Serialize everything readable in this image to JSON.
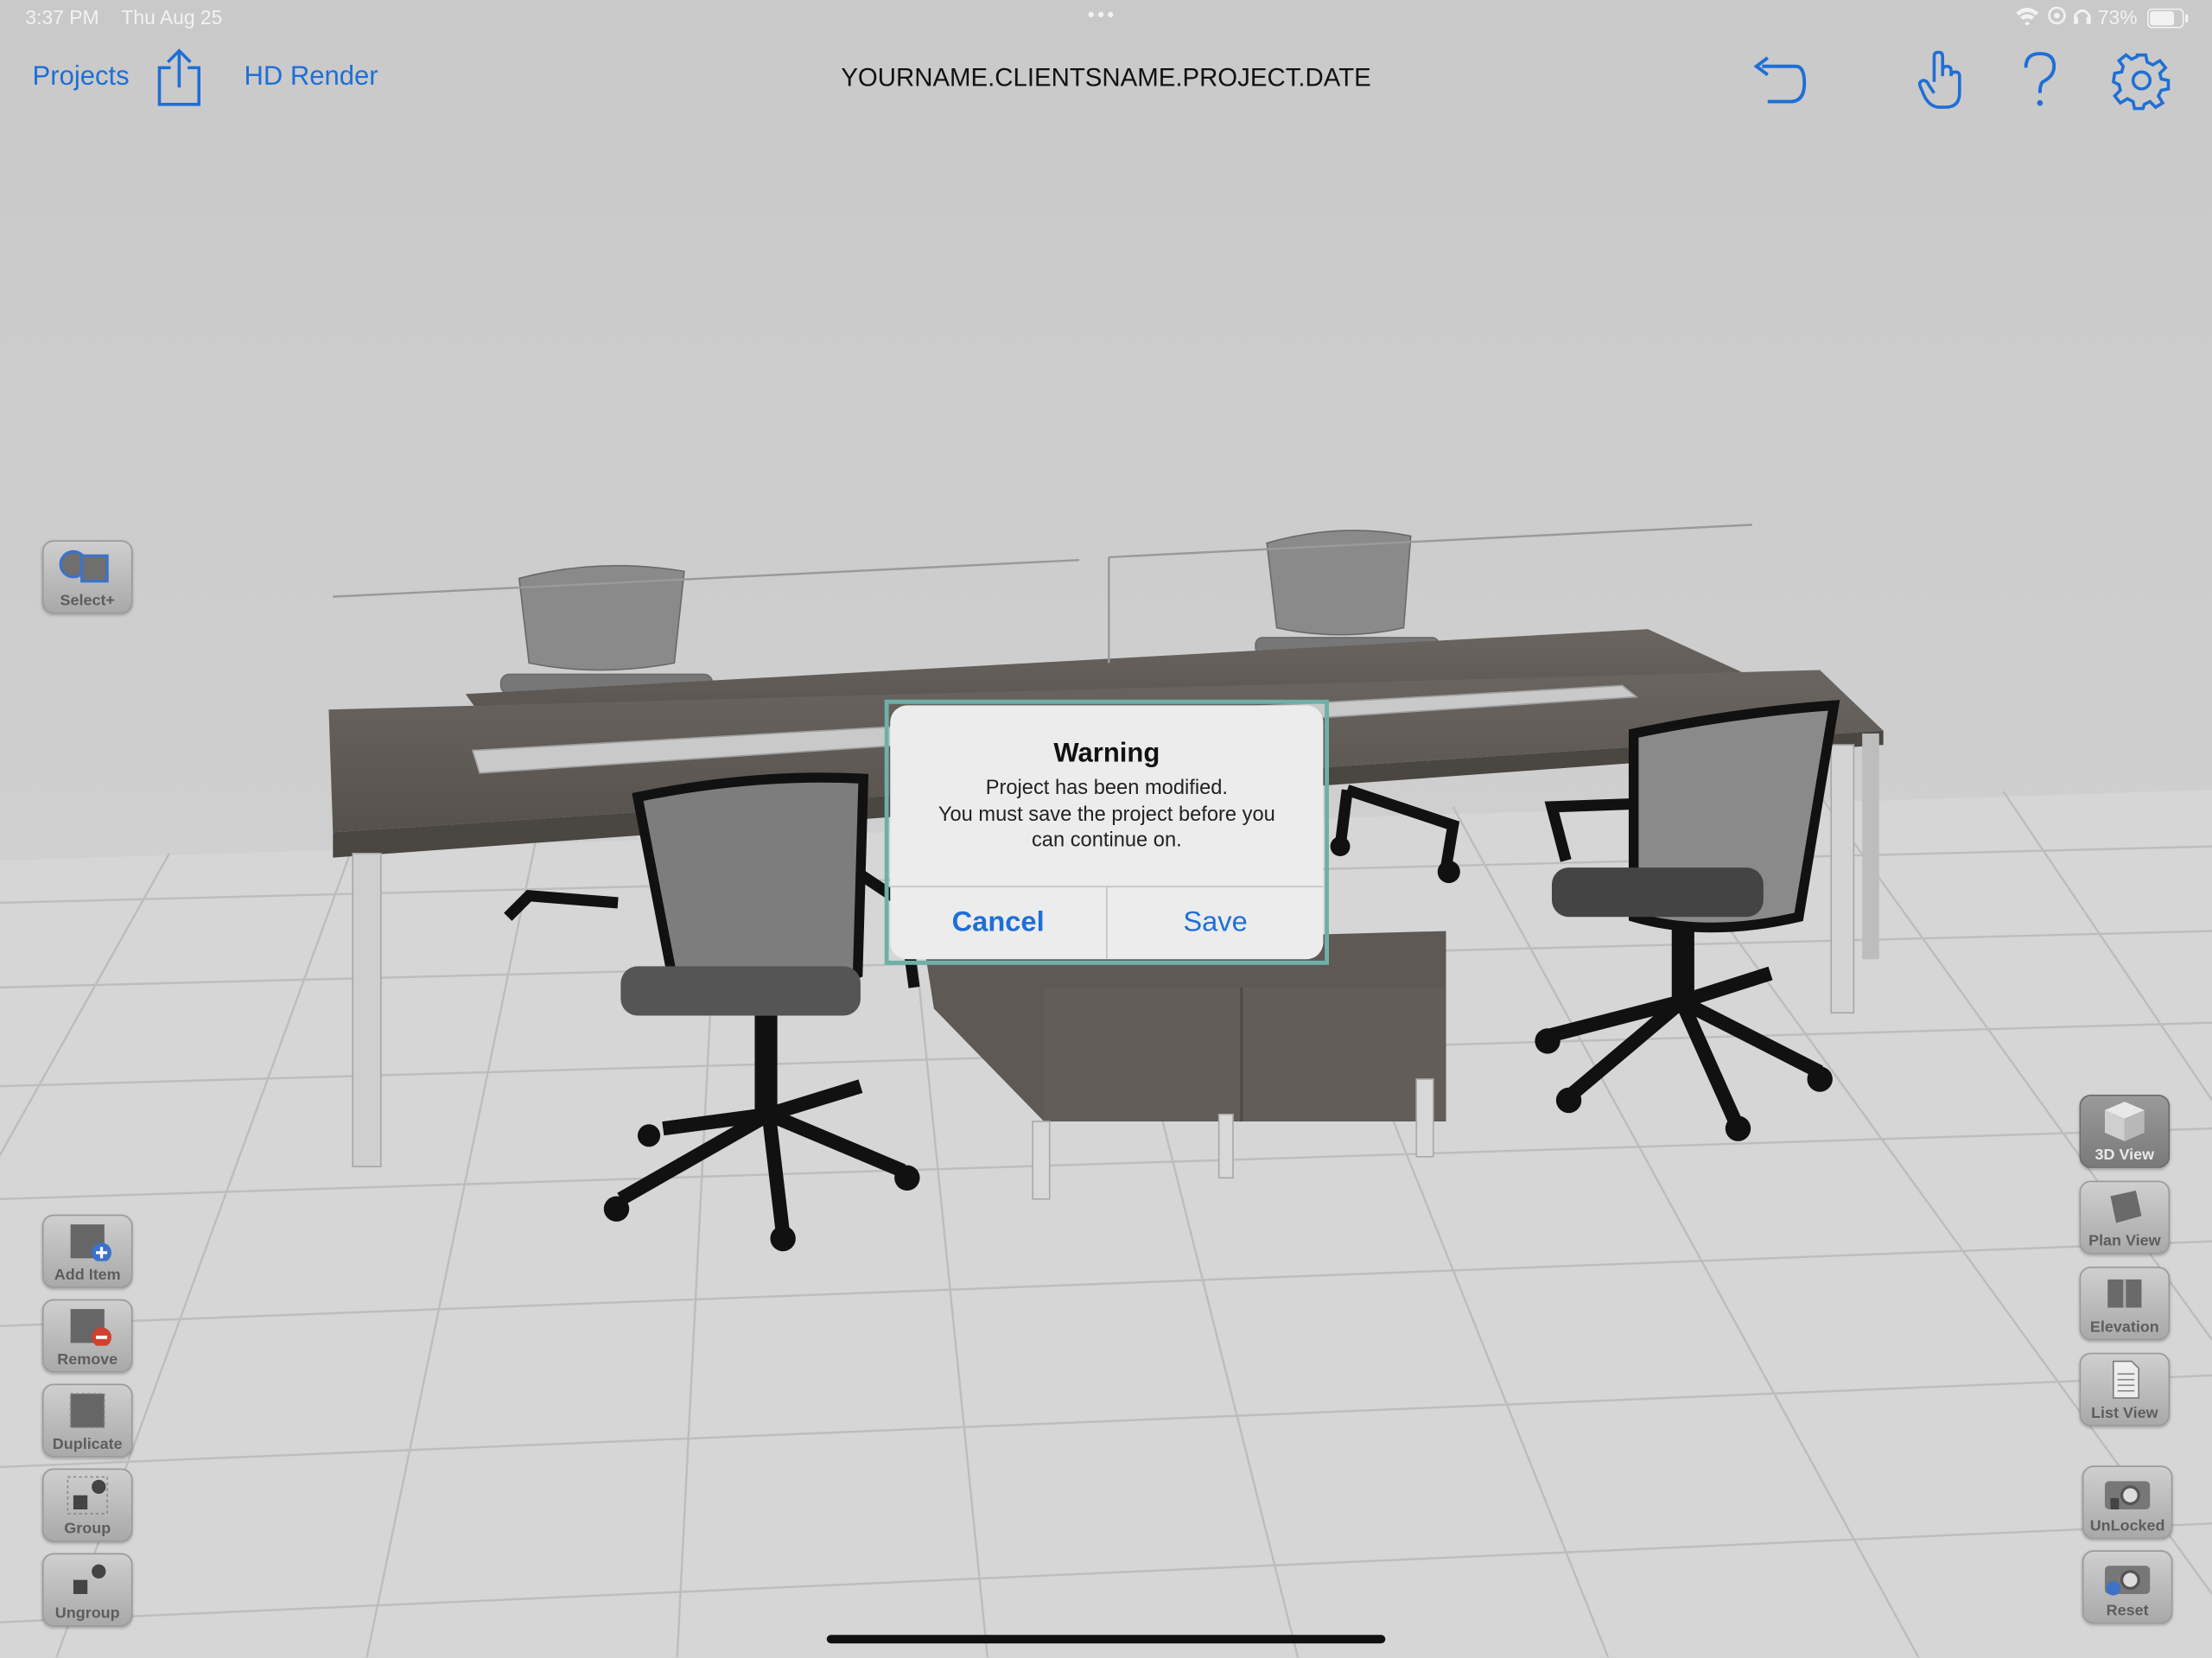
{
  "status_bar": {
    "time": "3:37 PM",
    "date": "Thu Aug 25",
    "battery": "73%"
  },
  "topbar": {
    "projects_label": "Projects",
    "hd_render_label": "HD Render",
    "title": "YOURNAME.CLIENTSNAME.PROJECT.DATE"
  },
  "left_tools": {
    "select": "Select+",
    "add": "Add Item",
    "remove": "Remove",
    "duplicate": "Duplicate",
    "group": "Group",
    "ungroup": "Ungroup"
  },
  "right_tools": {
    "view3d": "3D View",
    "plan": "Plan View",
    "elevation": "Elevation",
    "list": "List View",
    "unlocked": "UnLocked",
    "reset": "Reset"
  },
  "dialog": {
    "title": "Warning",
    "message_line1": "Project has been modified.",
    "message_line2": "You must save the project before you",
    "message_line3": "can continue on.",
    "cancel": "Cancel",
    "save": "Save"
  },
  "colors": {
    "accent": "#1f6fd6",
    "dialog_border": "#6fb0a9",
    "desk": "#5f5a55",
    "floor": "#d7d7d7"
  }
}
